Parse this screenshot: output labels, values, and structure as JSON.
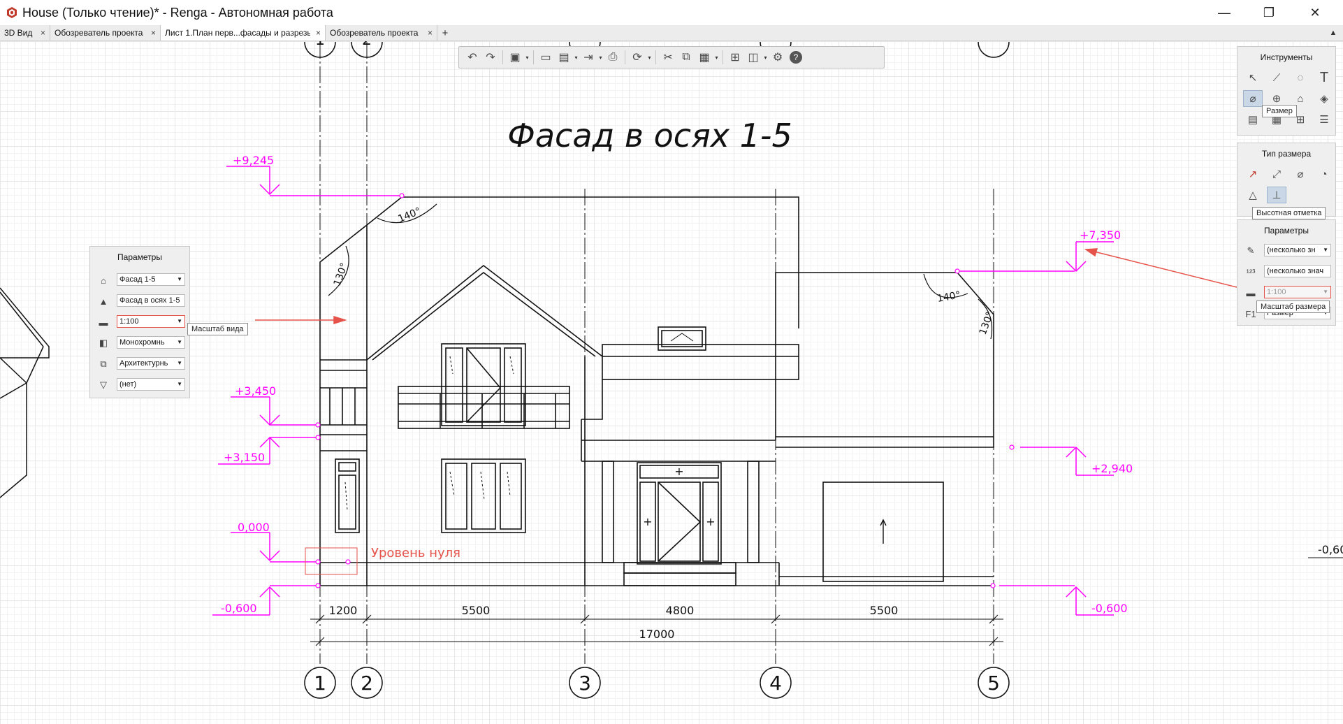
{
  "window": {
    "title": "House (Только чтение)* - Renga - Автономная работа",
    "minimize": "—",
    "restore": "❐",
    "close": "✕"
  },
  "tabs": [
    {
      "label": "3D Вид",
      "active": false
    },
    {
      "label": "Обозреватель проекта",
      "active": false
    },
    {
      "label": "Лист 1.План перв...фасады и разрезы",
      "active": true
    },
    {
      "label": "Обозреватель проекта",
      "active": false
    }
  ],
  "tab_close": "×",
  "tab_add": "+",
  "tab_scroll": "▲",
  "drawing": {
    "title": "Фасад в осях 1-5",
    "zero_level_label": "Уровень нуля",
    "elevations": {
      "left_top": "+9,245",
      "left_a": "+3,450",
      "left_b": "+3,150",
      "left_zero": "0,000",
      "left_bottom": "-0,600",
      "right_top": "+7,350",
      "right_mid": "+2,940",
      "right_bottom": "-0,600",
      "edge_cut": "-0,60"
    },
    "angles": {
      "a1": "140°",
      "a2": "130°",
      "a3": "140°",
      "a4": "130°"
    },
    "dimensions": {
      "d1": "1200",
      "d2": "5500",
      "d3": "4800",
      "d4": "5500",
      "total": "17000"
    },
    "axes": [
      "1",
      "2",
      "3",
      "4",
      "5"
    ],
    "door_plus": "+"
  },
  "toolbar": {
    "undo": "↶",
    "redo": "↷",
    "view3d": "▣",
    "open": "▭",
    "save": "▤",
    "export": "⇥",
    "print": "⎙",
    "sync": "⟳",
    "cut": "✂",
    "copy": "⧉",
    "paste": "▦",
    "properties": "⊞",
    "layers": "◫",
    "settings": "⚙",
    "help": "?",
    "drop": "▾"
  },
  "params_left": {
    "title": "Параметры",
    "view": "Фасад 1-5",
    "name": "Фасад в осях 1-5",
    "scale": "1:100",
    "display_mode": "Монохромнь",
    "style": "Архитектурнь",
    "filter": "(нет)",
    "scale_tooltip": "Масштаб вида"
  },
  "tools_panel": {
    "title": "Инструменты",
    "tooltip": "Размер",
    "text_tool": "T"
  },
  "dim_type_panel": {
    "title": "Тип размера",
    "tooltip": "Высотная отметка"
  },
  "params_right": {
    "title": "Параметры",
    "value1": "(несколько зн",
    "value2": "(несколько знач",
    "scale": "1:100",
    "tooltip": "Масштаб размера",
    "style": "Размер",
    "f1": "F1"
  },
  "colors": {
    "dim": "#ff00ff",
    "callout": "#e5534b",
    "line": "#111111",
    "panel": "#efefef"
  }
}
